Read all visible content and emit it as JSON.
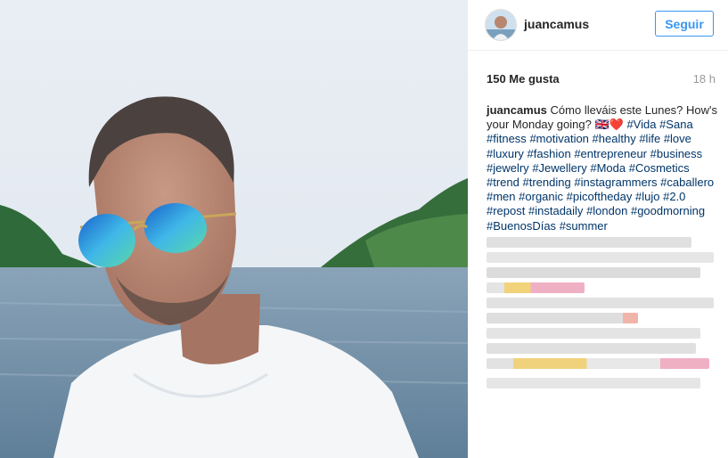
{
  "post": {
    "username": "juancamus",
    "follow_label": "Seguir",
    "likes": "150 Me gusta",
    "time": "18 h",
    "caption_user": "juancamus",
    "caption_text": "Cómo lleváis este Lunes? How's your Monday going?",
    "caption_emojis": "🇬🇧❤️",
    "hashtags": [
      "#Vida",
      "#Sana",
      "#fitness",
      "#motivation",
      "#healthy",
      "#life",
      "#love",
      "#luxury",
      "#fashion",
      "#entrepreneur",
      "#business",
      "#jewelry",
      "#Jewellery",
      "#Moda",
      "#Cosmetics",
      "#trend",
      "#trending",
      "#instagrammers",
      "#caballero",
      "#men",
      "#organic",
      "#picoftheday",
      "#lujo",
      "#2.0",
      "#repost",
      "#instadaily",
      "#london",
      "#goodmorning",
      "#BuenosDías",
      "#summer"
    ]
  },
  "colors": {
    "accent": "#3897f0",
    "hashtag": "#003569"
  },
  "icons": [
    "avatar-photo"
  ]
}
